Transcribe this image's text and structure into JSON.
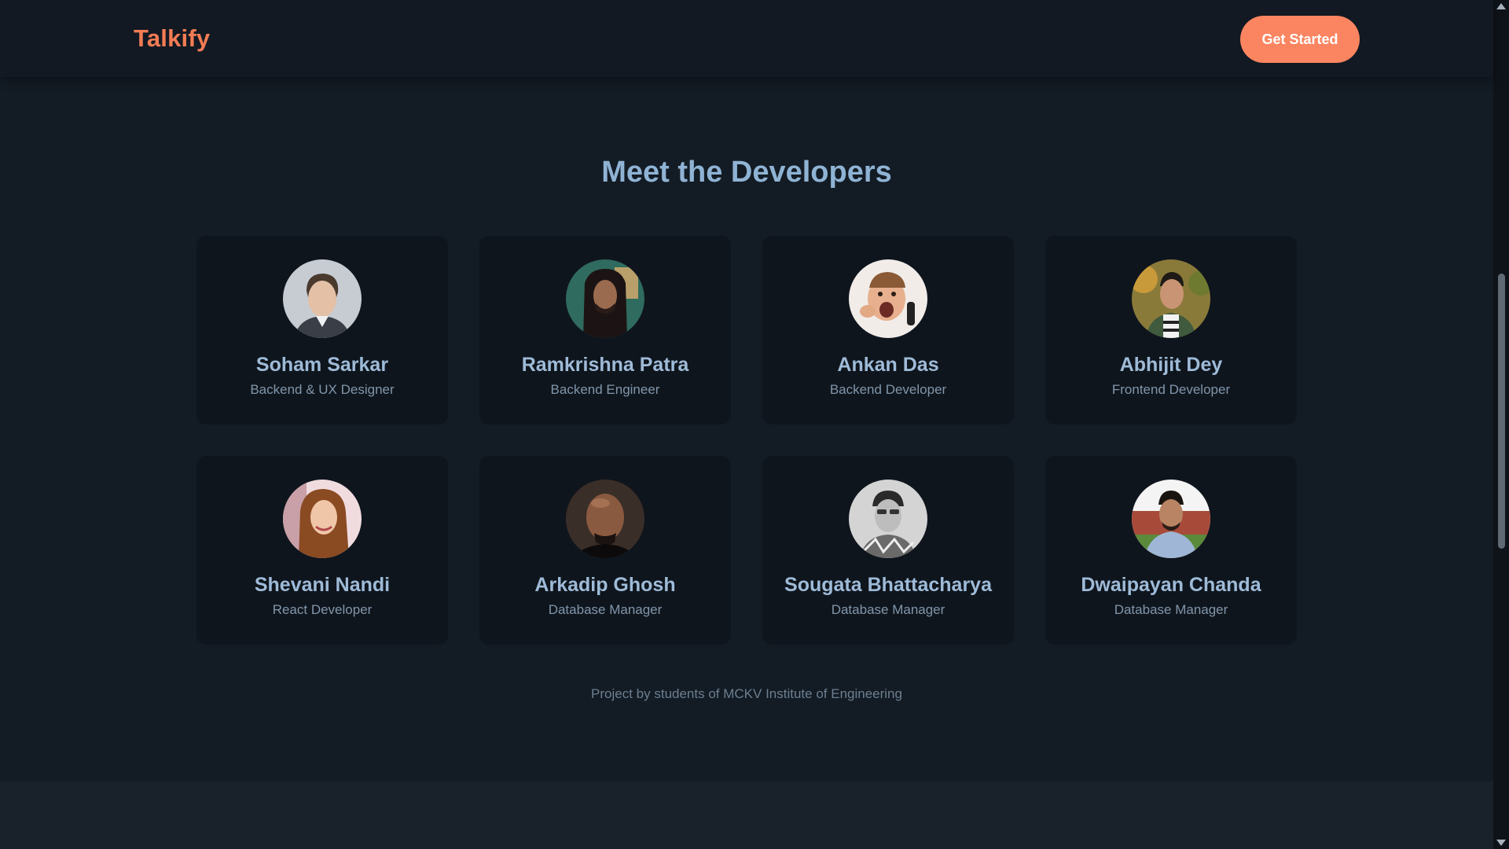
{
  "nav": {
    "brand": "Talkify",
    "cta_label": "Get Started"
  },
  "section": {
    "heading": "Meet the Developers"
  },
  "developers": [
    {
      "name": "Soham Sarkar",
      "role": "Backend & UX Designer"
    },
    {
      "name": "Ramkrishna Patra",
      "role": "Backend Engineer"
    },
    {
      "name": "Ankan Das",
      "role": "Backend Developer"
    },
    {
      "name": "Abhijit Dey",
      "role": "Frontend Developer"
    },
    {
      "name": "Shevani Nandi",
      "role": "React Developer"
    },
    {
      "name": "Arkadip Ghosh",
      "role": "Database Manager"
    },
    {
      "name": "Sougata Bhattacharya",
      "role": "Database Manager"
    },
    {
      "name": "Dwaipayan Chanda",
      "role": "Database Manager"
    }
  ],
  "footer": {
    "note": "Project by students of MCKV Institute of Engineering"
  },
  "colors": {
    "brand": "#f47c54",
    "cta": "#fb8560",
    "heading": "#8fb3d4",
    "background": "#131b24"
  }
}
